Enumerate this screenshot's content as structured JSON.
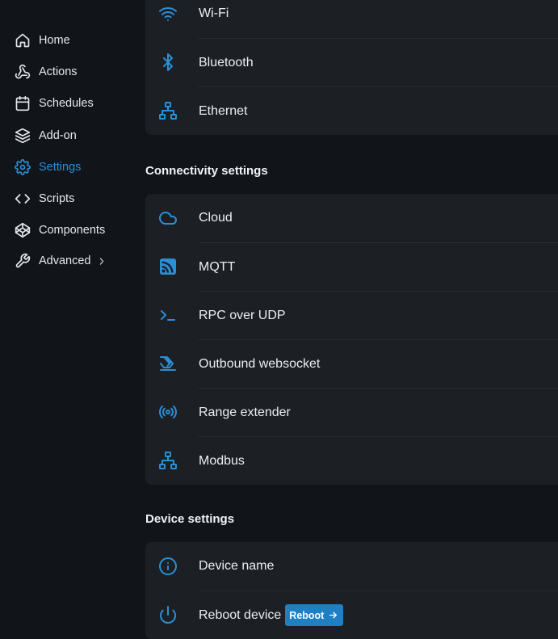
{
  "sidebar": {
    "items": [
      {
        "label": "Home",
        "icon": "home-icon"
      },
      {
        "label": "Actions",
        "icon": "webhook-icon"
      },
      {
        "label": "Schedules",
        "icon": "calendar-icon"
      },
      {
        "label": "Add-on",
        "icon": "layers-icon"
      },
      {
        "label": "Settings",
        "icon": "gear-icon",
        "active": true
      },
      {
        "label": "Scripts",
        "icon": "code-icon"
      },
      {
        "label": "Components",
        "icon": "cube-icon"
      },
      {
        "label": "Advanced",
        "icon": "wrench-icon"
      }
    ]
  },
  "network": {
    "rows": [
      {
        "label": "Wi-Fi",
        "icon": "wifi-icon"
      },
      {
        "label": "Bluetooth",
        "icon": "bluetooth-icon"
      },
      {
        "label": "Ethernet",
        "icon": "ethernet-icon"
      }
    ]
  },
  "connectivity": {
    "title": "Connectivity settings",
    "rows": [
      {
        "label": "Cloud",
        "icon": "cloud-icon"
      },
      {
        "label": "MQTT",
        "icon": "rss-icon"
      },
      {
        "label": "RPC over UDP",
        "icon": "terminal-icon"
      },
      {
        "label": "Outbound websocket",
        "icon": "websocket-icon"
      },
      {
        "label": "Range extender",
        "icon": "broadcast-icon"
      },
      {
        "label": "Modbus",
        "icon": "network-icon"
      }
    ]
  },
  "device": {
    "title": "Device settings",
    "rows": [
      {
        "label": "Device name",
        "icon": "info-icon"
      },
      {
        "label": "Reboot device",
        "icon": "power-icon"
      }
    ],
    "reboot_button_label": "Reboot"
  },
  "colors": {
    "accent": "#2b8fd6",
    "background": "#111418",
    "card": "#1c1f24",
    "button": "#1e7fc2"
  }
}
